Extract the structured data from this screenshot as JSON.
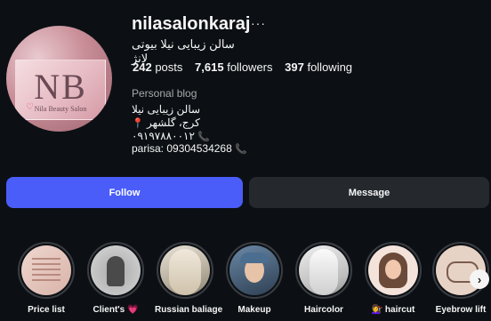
{
  "profile": {
    "username": "nilasalonkaraj",
    "full_name": "سالن زیبایی نیلا بیوتی لانژ",
    "avatar": {
      "logo_text": "NB",
      "brand_text": "Nila Beauty Salon"
    },
    "stats": {
      "posts_count": "242",
      "posts_label": "posts",
      "followers_count": "7,615",
      "followers_label": "followers",
      "following_count": "397",
      "following_label": "following"
    },
    "category": "Personal blog",
    "bio": {
      "line1": "سالن زیبایی نیلا",
      "line2": "کرج، گلشهر",
      "line3": "۰۹۱۹۷۸۸۰۰۱۲",
      "line4": "parisa: 09304534268"
    }
  },
  "actions": {
    "follow_label": "Follow",
    "message_label": "Message"
  },
  "highlights": [
    {
      "label": "Price list"
    },
    {
      "label": "Client's 💗"
    },
    {
      "label": "Russian baliage"
    },
    {
      "label": "Makeup"
    },
    {
      "label": "Haircolor"
    },
    {
      "label": "💇‍♀️ haircut"
    },
    {
      "label": "Eyebrow lift"
    }
  ],
  "icons": {
    "more": "ellipsis-icon",
    "pin": "location-pin-icon",
    "phone": "phone-icon",
    "next": "chevron-right-icon"
  },
  "colors": {
    "background": "#0c1014",
    "follow_button": "#4a5df9",
    "message_button": "#25292e",
    "accent": "#e0245e"
  }
}
